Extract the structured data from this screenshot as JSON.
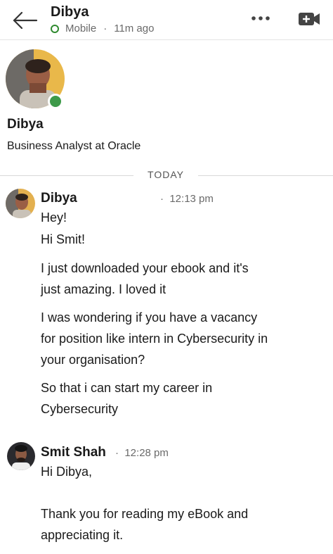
{
  "header": {
    "contact_name": "Dibya",
    "status": "Mobile",
    "last_seen": "11m ago",
    "icons": {
      "back": "back-arrow-icon",
      "more": "more-dots-icon",
      "video": "video-call-icon"
    }
  },
  "profile": {
    "name": "Dibya",
    "headline": "Business Analyst at Oracle"
  },
  "divider": {
    "label": "TODAY"
  },
  "messages": [
    {
      "sender": "Dibya",
      "time": "12:13 pm",
      "lines": [
        "Hey!",
        "Hi Smit!",
        "I just downloaded your ebook and it's",
        "just amazing. I loved it",
        "I was wondering if you have a vacancy",
        "for position like intern in Cybersecurity in",
        "your organisation?",
        "So that i can start my career in",
        "Cybersecurity"
      ]
    },
    {
      "sender": "Smit Shah",
      "time": "12:28 pm",
      "lines": [
        "Hi Dibya,",
        "Thank you for reading my eBook and",
        "appreciating it."
      ]
    }
  ],
  "colors": {
    "online": "#3e9a4a",
    "divider": "#d9d9d9",
    "muted_text": "#6a6a6a"
  }
}
